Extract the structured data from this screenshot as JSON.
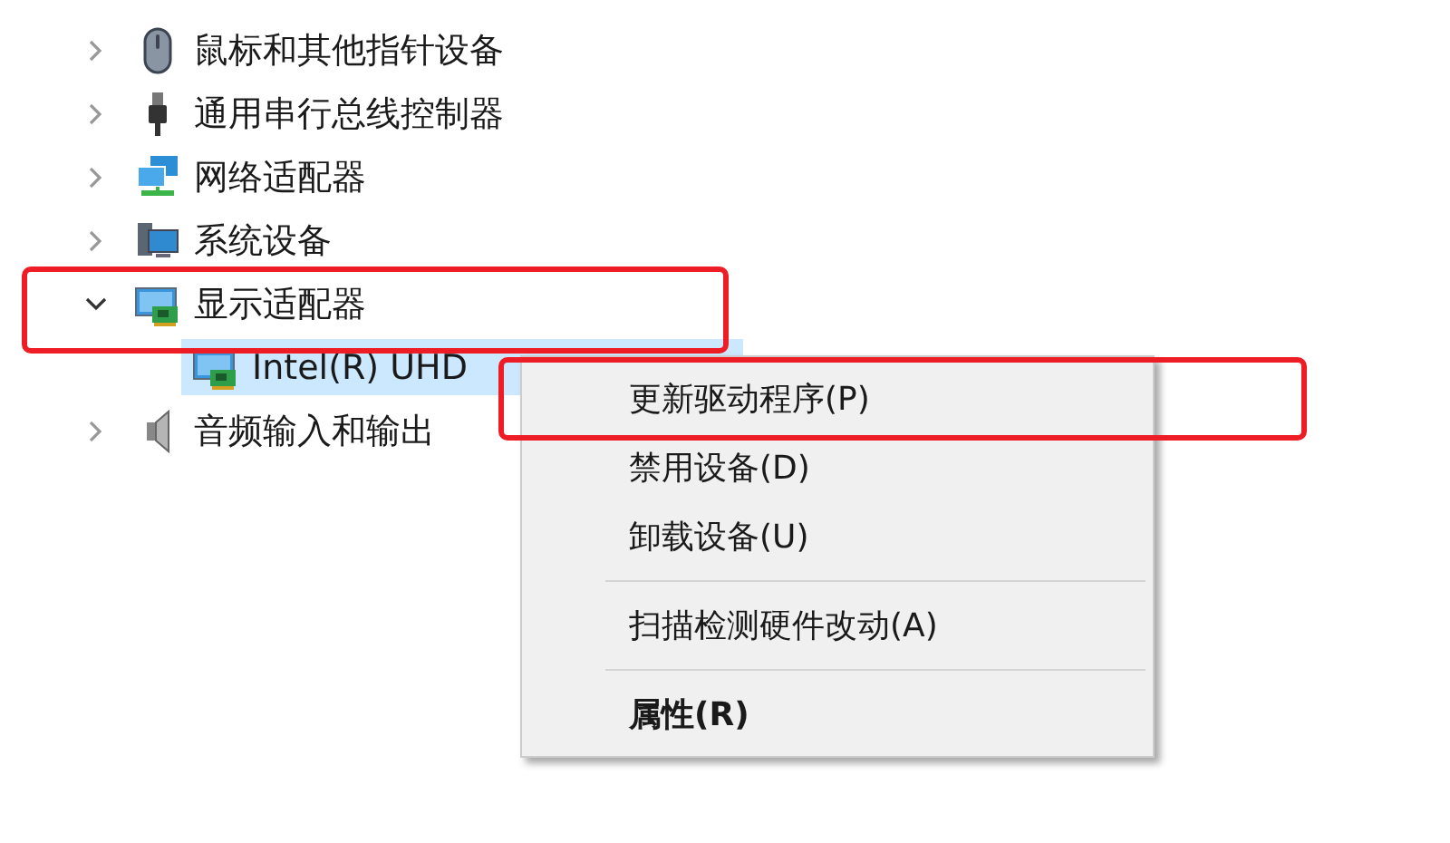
{
  "tree": [
    {
      "label": "鼠标和其他指针设备",
      "kind": "mouse",
      "expanded": false,
      "marked": false
    },
    {
      "label": "通用串行总线控制器",
      "kind": "usb",
      "expanded": false,
      "marked": false
    },
    {
      "label": "网络适配器",
      "kind": "network",
      "expanded": false,
      "marked": false
    },
    {
      "label": "系统设备",
      "kind": "system",
      "expanded": false,
      "marked": false
    },
    {
      "label": "显示适配器",
      "kind": "display",
      "expanded": true,
      "marked": true,
      "children": [
        {
          "label": "Intel(R) UHD",
          "kind": "display",
          "selected": true
        }
      ]
    },
    {
      "label": "音频输入和输出",
      "kind": "audio",
      "expanded": false,
      "marked": false
    }
  ],
  "context_menu": [
    {
      "kind": "item",
      "label": "更新驱动程序(P)",
      "bold": false,
      "marked": true
    },
    {
      "kind": "item",
      "label": "禁用设备(D)",
      "bold": false,
      "marked": false
    },
    {
      "kind": "item",
      "label": "卸载设备(U)",
      "bold": false,
      "marked": false
    },
    {
      "kind": "separator"
    },
    {
      "kind": "item",
      "label": "扫描检测硬件改动(A)",
      "bold": false,
      "marked": false
    },
    {
      "kind": "separator"
    },
    {
      "kind": "item",
      "label": "属性(R)",
      "bold": true,
      "marked": false
    }
  ]
}
